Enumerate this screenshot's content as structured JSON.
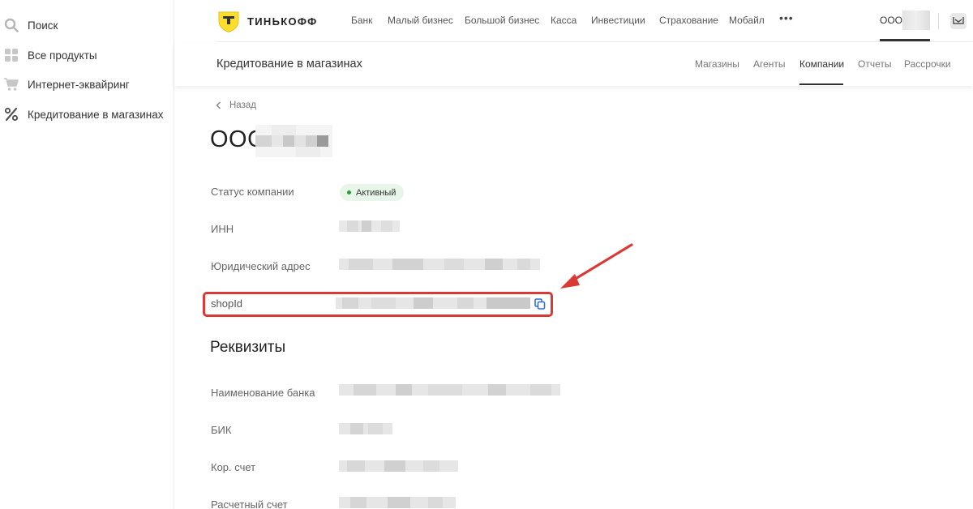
{
  "sidebar": {
    "items": [
      {
        "label": "Поиск",
        "icon": "search-icon"
      },
      {
        "label": "Все продукты",
        "icon": "grid-icon"
      },
      {
        "label": "Интернет-эквайринг",
        "icon": "cart-icon"
      },
      {
        "label": "Кредитование в магазинах",
        "icon": "percent-icon"
      }
    ]
  },
  "header": {
    "logo_text": "ТИНЬКОФФ",
    "nav": [
      "Банк",
      "Малый бизнес",
      "Большой бизнес",
      "Касса",
      "Инвестиции",
      "Страхование",
      "Мобайл"
    ],
    "more": "•••",
    "org_prefix": "ООО"
  },
  "subheader": {
    "title": "Кредитование в магазинах",
    "tabs": [
      "Магазины",
      "Агенты",
      "Компании",
      "Отчеты",
      "Рассрочки"
    ],
    "active_tab": "Компании"
  },
  "content": {
    "back_label": "Назад",
    "company_prefix": "ООО",
    "fields": {
      "status_label": "Статус компании",
      "status_value": "Активный",
      "inn_label": "ИНН",
      "address_label": "Юридический адрес",
      "shopid_label": "shopId"
    },
    "requisites_title": "Реквизиты",
    "requisites": {
      "bank_label": "Наименование банка",
      "bik_label": "БИК",
      "corr_label": "Кор. счет",
      "account_label": "Расчетный счет"
    }
  },
  "colors": {
    "highlight": "#d93a35",
    "status_dot": "#2e9c3c",
    "status_bg": "#e8f6ea",
    "copy_icon": "#2f6fe0",
    "logo_yellow": "#ffdd2d"
  }
}
